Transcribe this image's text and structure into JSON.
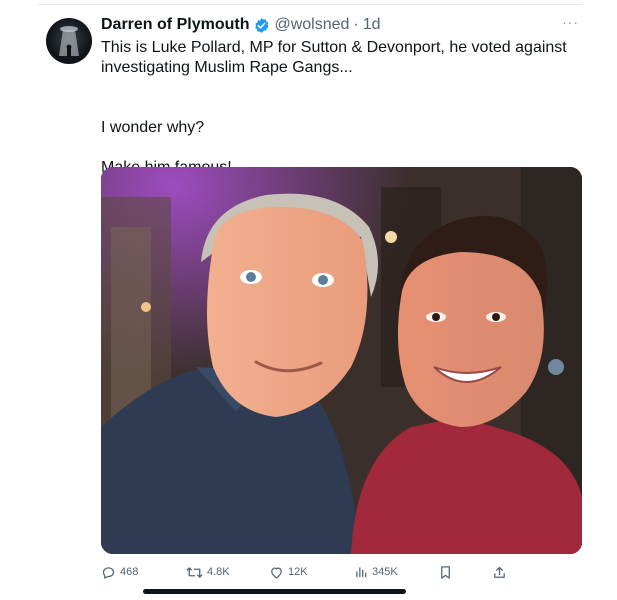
{
  "tweet": {
    "display_name": "Darren of Plymouth",
    "handle": "@wolsned",
    "separator": "·",
    "time": "1d",
    "more": "···",
    "text_line1": "This is Luke Pollard, MP for Sutton & Devonport, he voted against investigating Muslim Rape Gangs...",
    "text_line2": "I wonder why?",
    "text_line3": "Make him famous!"
  },
  "actions": {
    "replies": "468",
    "retweets": "4.8K",
    "likes": "12K",
    "views": "345K"
  },
  "icons": [
    "verified-badge-icon",
    "more-icon",
    "reply-icon",
    "retweet-icon",
    "like-icon",
    "views-icon",
    "bookmark-icon",
    "share-icon"
  ],
  "colors": {
    "verified": "#1d9bf0",
    "secondary_text": "#536471",
    "text": "#0f1419"
  }
}
